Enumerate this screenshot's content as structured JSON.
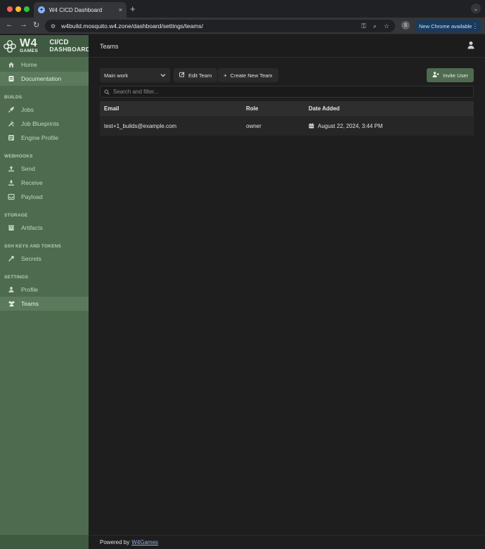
{
  "browser": {
    "tab_title": "W4 CICD Dashboard",
    "tab_close": "×",
    "new_tab": "+",
    "url": "w4build.mosquito.w4.zone/dashboard/settings/teams/",
    "profile_initial": "S",
    "update_label": "New Chrome available",
    "menu_glyph": "⋮"
  },
  "brand": {
    "logo_big": "W4",
    "logo_small": "GAMES",
    "cicd_top": "CI/CD",
    "cicd_bottom": "DASHBOARD"
  },
  "sidebar": {
    "top_items": [
      {
        "label": "Home",
        "icon": "home-icon"
      },
      {
        "label": "Documentation",
        "icon": "book-icon",
        "active": true
      }
    ],
    "sections": [
      {
        "title": "BUILDS",
        "items": [
          {
            "label": "Jobs",
            "icon": "rocket-icon"
          },
          {
            "label": "Job Blueprints",
            "icon": "tools-icon"
          },
          {
            "label": "Engine Profile",
            "icon": "list-icon"
          }
        ]
      },
      {
        "title": "WEBHOOKS",
        "items": [
          {
            "label": "Send",
            "icon": "upload-icon"
          },
          {
            "label": "Receive",
            "icon": "download-icon"
          },
          {
            "label": "Payload",
            "icon": "inbox-icon"
          }
        ]
      },
      {
        "title": "STORAGE",
        "items": [
          {
            "label": "Artifacts",
            "icon": "archive-icon"
          }
        ]
      },
      {
        "title": "SSH KEYS AND TOKENS",
        "items": [
          {
            "label": "Secrets",
            "icon": "key-icon"
          }
        ]
      },
      {
        "title": "SETTINGS",
        "items": [
          {
            "label": "Profile",
            "icon": "user-icon"
          },
          {
            "label": "Teams",
            "icon": "users-icon",
            "active": true
          }
        ]
      }
    ]
  },
  "main": {
    "title": "Teams",
    "team_select": "Main work",
    "edit_team": "Edit Team",
    "create_team": "Create New Team",
    "invite_user": "Invite User",
    "search_placeholder": "Search and filter...",
    "columns": {
      "email": "Email",
      "role": "Role",
      "date": "Date Added"
    },
    "rows": [
      {
        "email": "test+1_builds@example.com",
        "role": "owner",
        "date": "August 22, 2024, 3:44 PM"
      }
    ],
    "footer_prefix": "Powered by",
    "footer_link": "W4Games"
  },
  "colors": {
    "sidebar_bg": "#4e6b4f",
    "accent": "#4e6b4f",
    "main_bg": "#1e1e1e"
  }
}
